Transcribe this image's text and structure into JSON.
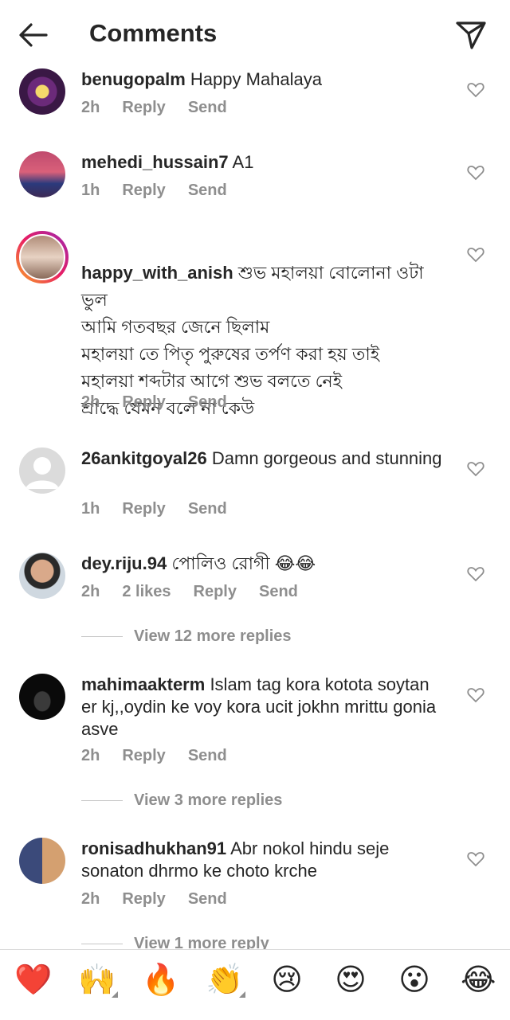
{
  "header": {
    "title": "Comments",
    "back_icon": "arrow-left-icon",
    "send_icon": "paper-plane-icon"
  },
  "comments": [
    {
      "username": "benugopalm",
      "text": "Happy Mahalaya",
      "time": "2h",
      "reply": "Reply",
      "send": "Send"
    },
    {
      "username": "mehedi_hussain7",
      "text": "A1",
      "time": "1h",
      "reply": "Reply",
      "send": "Send"
    },
    {
      "username": "happy_with_anish",
      "text": "শুভ মহালয়া বোলোনা ওটা ভুল\nআমি গতবছর জেনে ছিলাম\nমহালয়া তে পিতৃ পুরুষের তর্পণ করা হয় তাই\nমহালয়া শব্দটার আগে শুভ বলতে নেই\nশ্রাদ্ধে যেমন বলে না কেউ",
      "time": "2h",
      "reply": "Reply",
      "send": "Send"
    },
    {
      "username": "26ankitgoyal26",
      "text": "Damn gorgeous and stunning",
      "time": "1h",
      "reply": "Reply",
      "send": "Send"
    },
    {
      "username": "dey.riju.94",
      "text": "পোলিও রোগী 😂😂",
      "time": "2h",
      "likes": "2 likes",
      "reply": "Reply",
      "send": "Send",
      "view_more": "View 12 more replies"
    },
    {
      "username": "mahimaakterm",
      "text": "Islam tag kora kotota soytan er kj,,oydin ke voy kora ucit jokhn mrittu gonia asve",
      "time": "2h",
      "reply": "Reply",
      "send": "Send",
      "view_more": "View 3 more replies"
    },
    {
      "username": "ronisadhukhan91",
      "text": "Abr nokol hindu seje sonaton dhrmo ke choto krche",
      "time": "2h",
      "reply": "Reply",
      "send": "Send",
      "view_more": "View 1 more reply"
    }
  ],
  "emoji_bar": [
    "❤️",
    "🙌",
    "🔥",
    "👏",
    "😢",
    "😍",
    "😮",
    "😂"
  ],
  "colors": {
    "text": "#262626",
    "secondary": "#8e8e8e",
    "story_ring_start": "#f9a825",
    "story_ring_end": "#c2185b"
  }
}
